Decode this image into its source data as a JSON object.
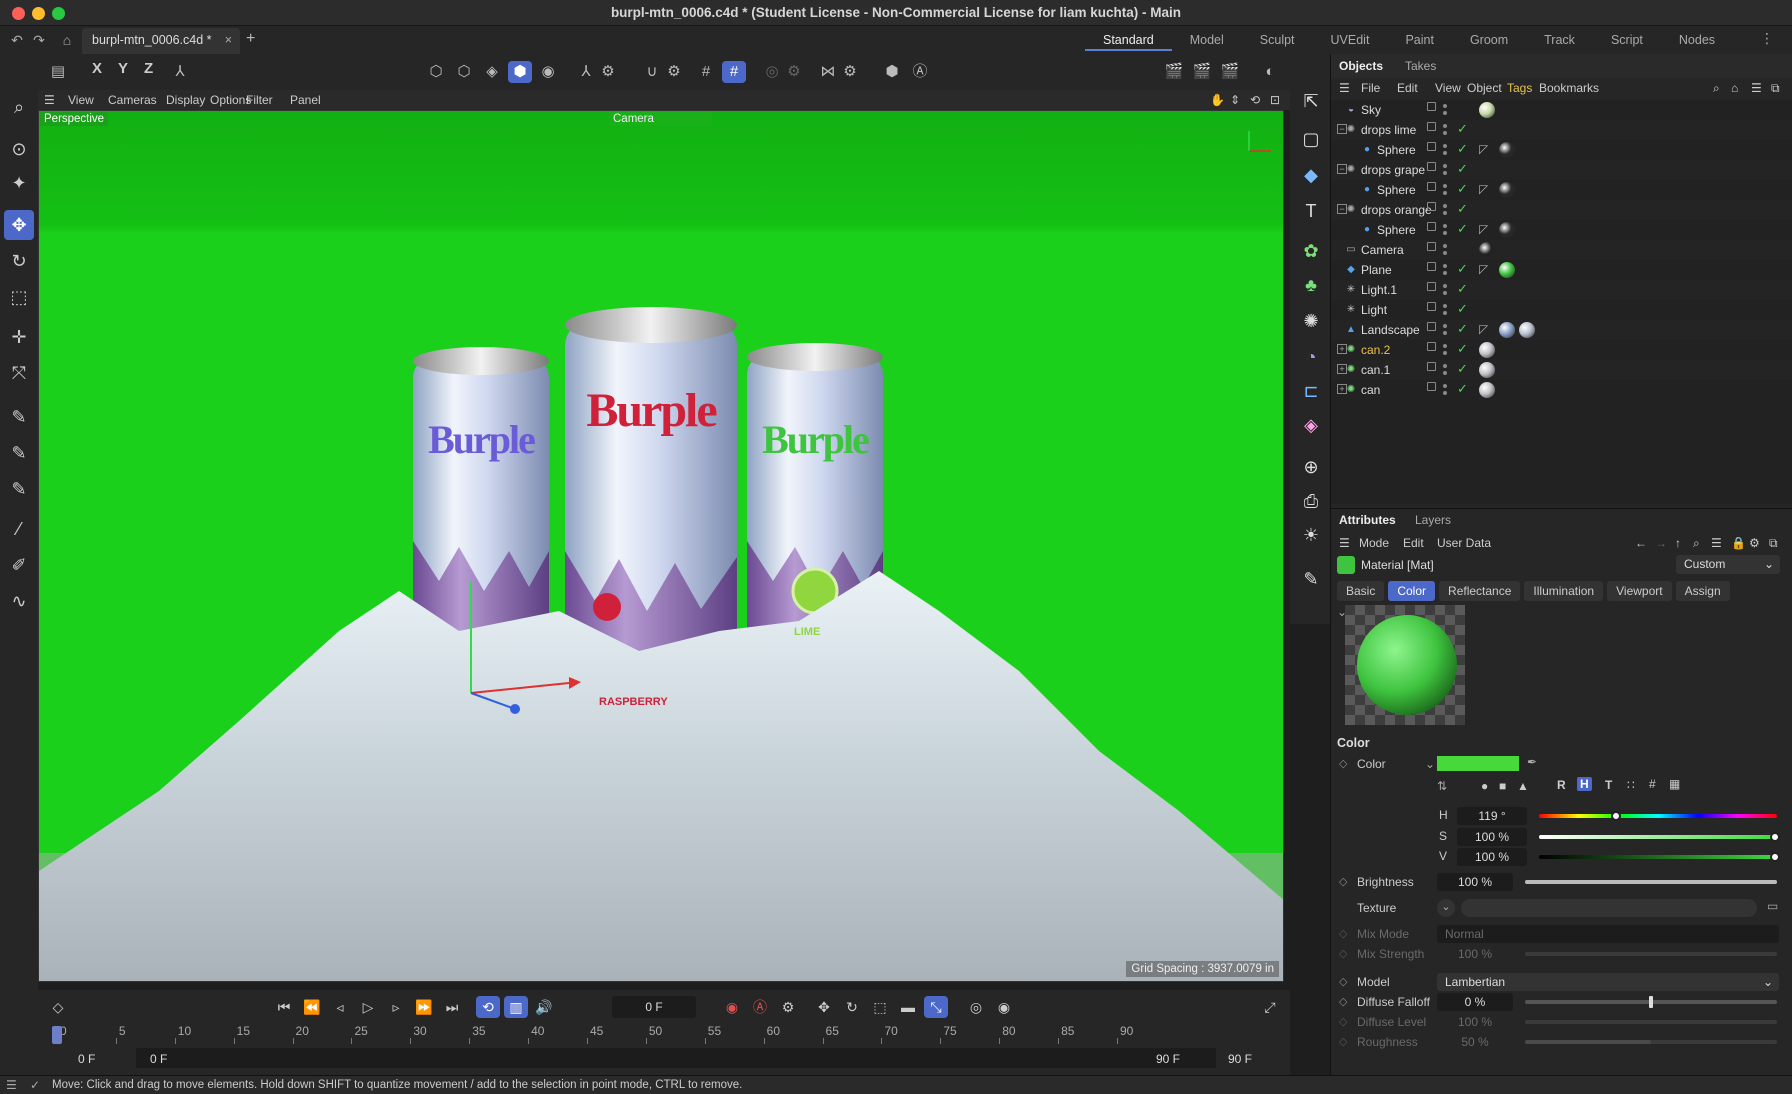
{
  "window": {
    "title": "burpl-mtn_0006.c4d * (Student License - Non-Commercial License for liam kuchta) - Main",
    "tab": "burpl-mtn_0006.c4d *",
    "tab_close": "×",
    "new_tab": "+"
  },
  "layouts": [
    "Standard",
    "Model",
    "Sculpt",
    "UVEdit",
    "Paint",
    "Groom",
    "Track",
    "Script",
    "Nodes"
  ],
  "axes": {
    "x": "X",
    "y": "Y",
    "z": "Z"
  },
  "viewport": {
    "menu": [
      "View",
      "Cameras",
      "Display",
      "Options",
      "Filter",
      "Panel"
    ],
    "view_label": "Perspective",
    "camera_label": "Camera",
    "grid_spacing": "Grid Spacing : 3937.0079 in",
    "background": "#1bd01b",
    "cans": [
      {
        "brand": "Burple",
        "brand_color": "#6a5bd6",
        "flavor": "",
        "fruit_color": "#8a6be0"
      },
      {
        "brand": "Burple",
        "brand_color": "#d0213a",
        "flavor": "RASPBERRY",
        "fruit_color": "#d0213a"
      },
      {
        "brand": "Burple",
        "brand_color": "#3fc43f",
        "flavor": "LIME",
        "fruit_color": "#8fd63f"
      }
    ]
  },
  "objects": {
    "tabs": [
      "Objects",
      "Takes"
    ],
    "menu": [
      "File",
      "Edit",
      "View",
      "Object",
      "Tags",
      "Bookmarks"
    ],
    "rows": [
      {
        "name": "Sky",
        "indent": 0,
        "expander": "",
        "icon": "sky-icon",
        "color": "#ddd",
        "check": false,
        "tags": [
          "#c8d8a8"
        ]
      },
      {
        "name": "drops lime",
        "indent": 0,
        "expander": "−",
        "icon": "emitter-icon",
        "color": "#ddd",
        "check": true,
        "tags": []
      },
      {
        "name": "Sphere",
        "indent": 1,
        "expander": "",
        "icon": "sphere-icon",
        "color": "#ddd",
        "check": true,
        "tags": [
          "phong",
          "#2a2a2a"
        ]
      },
      {
        "name": "drops grape",
        "indent": 0,
        "expander": "−",
        "icon": "emitter-icon",
        "color": "#ddd",
        "check": true,
        "tags": []
      },
      {
        "name": "Sphere",
        "indent": 1,
        "expander": "",
        "icon": "sphere-icon",
        "color": "#ddd",
        "check": true,
        "tags": [
          "phong",
          "#2a2a2a"
        ]
      },
      {
        "name": "drops orange",
        "indent": 0,
        "expander": "−",
        "icon": "emitter-icon",
        "color": "#ddd",
        "check": true,
        "tags": []
      },
      {
        "name": "Sphere",
        "indent": 1,
        "expander": "",
        "icon": "sphere-icon",
        "color": "#ddd",
        "check": true,
        "tags": [
          "phong",
          "#2a2a2a"
        ]
      },
      {
        "name": "Camera",
        "indent": 0,
        "expander": "",
        "icon": "camera-icon",
        "color": "#ddd",
        "check": false,
        "tags": [
          "#222"
        ]
      },
      {
        "name": "Plane",
        "indent": 0,
        "expander": "",
        "icon": "plane-icon",
        "color": "#ddd",
        "check": true,
        "tags": [
          "phong",
          "#3fc43f"
        ]
      },
      {
        "name": "Light.1",
        "indent": 0,
        "expander": "",
        "icon": "light-icon",
        "color": "#ddd",
        "check": true,
        "tags": []
      },
      {
        "name": "Light",
        "indent": 0,
        "expander": "",
        "icon": "light-icon",
        "color": "#ddd",
        "check": true,
        "tags": []
      },
      {
        "name": "Landscape",
        "indent": 0,
        "expander": "",
        "icon": "landscape-icon",
        "color": "#ddd",
        "check": true,
        "tags": [
          "phong",
          "#8a9fc8",
          "#b8c0d0"
        ]
      },
      {
        "name": "can.2",
        "indent": 0,
        "expander": "+",
        "icon": "null-icon",
        "color": "#e8c24a",
        "check": true,
        "tags": [
          "#c0c0c8"
        ]
      },
      {
        "name": "can.1",
        "indent": 0,
        "expander": "+",
        "icon": "null-icon",
        "color": "#ddd",
        "check": true,
        "tags": [
          "#c0c0c8"
        ]
      },
      {
        "name": "can",
        "indent": 0,
        "expander": "+",
        "icon": "null-icon",
        "color": "#ddd",
        "check": true,
        "tags": [
          "#c0c0c8"
        ]
      }
    ]
  },
  "attributes": {
    "tabs": [
      "Attributes",
      "Layers"
    ],
    "menu": [
      "Mode",
      "Edit",
      "User Data"
    ],
    "material_name": "Material [Mat]",
    "custom": "Custom",
    "subtabs": [
      "Basic",
      "Color",
      "Reflectance",
      "Illumination",
      "Viewport",
      "Assign"
    ],
    "section": "Color",
    "color_label": "Color",
    "color_value": "#47d93a",
    "mode_buttons": [
      "R",
      "H",
      "T"
    ],
    "h_label": "H",
    "h_value": "119 °",
    "s_label": "S",
    "s_value": "100 %",
    "v_label": "V",
    "v_value": "100 %",
    "brightness_label": "Brightness",
    "brightness_value": "100 %",
    "texture_label": "Texture",
    "mix_mode_label": "Mix Mode",
    "mix_mode_value": "Normal",
    "mix_strength_label": "Mix Strength",
    "mix_strength_value": "100 %",
    "model_label": "Model",
    "model_value": "Lambertian",
    "diffuse_falloff_label": "Diffuse Falloff",
    "diffuse_falloff_value": "0 %",
    "diffuse_level_label": "Diffuse Level",
    "diffuse_level_value": "100 %",
    "roughness_label": "Roughness",
    "roughness_value": "50 %",
    "levels": {
      "hue": 0.33,
      "saturation": 1.0,
      "value": 1.0,
      "brightness": 1.0,
      "diffuse_falloff": 0.5,
      "roughness": 0.5
    }
  },
  "timeline": {
    "current_frame": "0 F",
    "ticks": [
      "0",
      "5",
      "10",
      "15",
      "20",
      "25",
      "30",
      "35",
      "40",
      "45",
      "50",
      "55",
      "60",
      "65",
      "70",
      "75",
      "80",
      "85",
      "90"
    ],
    "start_a": "0 F",
    "start_b": "0 F",
    "end_a": "90 F",
    "end_b": "90 F"
  },
  "status": {
    "message": "Move: Click and drag to move elements. Hold down SHIFT to quantize movement / add to the selection in point mode, CTRL to remove."
  }
}
